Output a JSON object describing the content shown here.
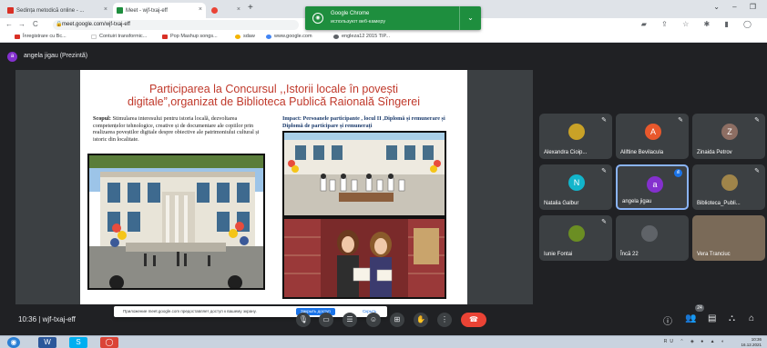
{
  "browser": {
    "tabs": [
      {
        "label": "Sedința metodică online - ...",
        "favicon_color": "#d93025"
      },
      {
        "label": "Meet - wjf-txaj-eff",
        "favicon_color": "#1e8e3e",
        "active": true
      },
      {
        "label": "",
        "favicon_color": "#ea4335"
      }
    ],
    "new_tab": "+",
    "window_controls": "⌄ – ❐"
  },
  "notification": {
    "title": "Google Chrome",
    "subtitle": "используют веб-камеру",
    "icon": "camera-icon"
  },
  "addressbar": {
    "url": "meet.google.com/wjf-txaj-eff",
    "back": "←",
    "forward": "→",
    "reload": "C"
  },
  "bookmarks": [
    {
      "label": "Înregistrare cu Bc...",
      "color": "#d93025"
    },
    {
      "label": "Contuiri transformic...",
      "color": "#ffffff"
    },
    {
      "label": "Pop Mashup songs...",
      "color": "#d93025"
    },
    {
      "label": "sdaw",
      "color": "#f4b400"
    },
    {
      "label": "www.google.com",
      "color": "#4285f4"
    },
    {
      "label": "engleza12 2015 TIP...",
      "color": "#5f6368"
    }
  ],
  "meet": {
    "presenter_initial": "a",
    "presenter": "angela jigau (Prezintă)",
    "time": "10:36",
    "meeting_code": "wjf-txaj-eff",
    "participants_count": "24",
    "participants": [
      {
        "name": "Alexandra Cioip...",
        "type": "photo",
        "color": "#c9a227"
      },
      {
        "name": "Aliftine Bevilacula",
        "type": "initial",
        "initial": "A",
        "color": "#e8582c"
      },
      {
        "name": "Zinaida Petrov",
        "type": "initial",
        "initial": "Z",
        "color": "#8d6e63"
      },
      {
        "name": "Natalia Galbur",
        "type": "initial",
        "initial": "N",
        "color": "#12b5cb"
      },
      {
        "name": "angela jigau",
        "type": "initial",
        "initial": "a",
        "color": "#8430ce",
        "speaking": true
      },
      {
        "name": "Biblioteca_Publi...",
        "type": "photo",
        "color": "#a0854a"
      },
      {
        "name": "Iunie Fontai",
        "type": "photo",
        "color": "#6b8e23"
      },
      {
        "name": "Încă 22",
        "type": "more"
      },
      {
        "name": "Vera Tranciuc",
        "type": "photo",
        "color": "#7a6a58"
      }
    ]
  },
  "slide": {
    "title_line1": "Participarea la Concursul ,,Istorii locale în povești",
    "title_line2": "digitale”,organizat de Biblioteca Publică Raională Sîngerei",
    "scop_label": "Scopul:",
    "scop_text": " Stimularea interesului pentru istoria locală, dezvoltarea competențelor tehnologice, creative și de documentare ale copiilor prin realizarea poveștilor digitale despre obiective ale patrimoniului cultural și istoric din localitate.",
    "impact_text": "Impact: Persoanele participante , locul II ,Diplomă și remunerare și Diplomă de participare și remunerați"
  },
  "share_prompt": {
    "text": "Приложение meet.google.com предоставляет доступ к вашему экрану.",
    "share": "Закрыть доступ",
    "hide": "Скрыть"
  },
  "taskbar": {
    "apps": [
      {
        "label": "◉",
        "color": "#2a7fd4"
      },
      {
        "label": "W",
        "color": "#2b579a"
      },
      {
        "label": "S",
        "color": "#00aff0"
      },
      {
        "label": "◯",
        "color": "#db4437"
      }
    ],
    "tray": "RU ⌃ ◈ ● ▲ ◐",
    "time": "10:36",
    "date": "16.12.2021"
  },
  "colors": {
    "meet_bg": "#202124",
    "tile_bg": "#3c4043",
    "end_call": "#ea4335",
    "slide_title": "#c0392b",
    "notification": "#1e8e3e"
  }
}
